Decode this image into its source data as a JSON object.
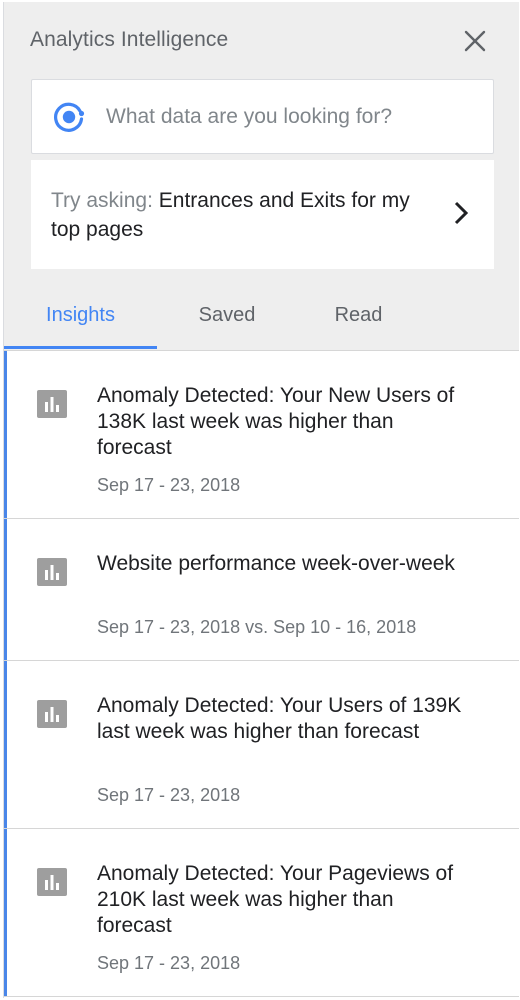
{
  "header": {
    "title": "Analytics Intelligence",
    "close_icon": "close-icon"
  },
  "search": {
    "icon": "analytics-intelligence-icon",
    "placeholder": "What data are you looking for?",
    "value": ""
  },
  "suggestion": {
    "prefix": "Try asking:",
    "query": "Entrances and Exits for my top pages",
    "chevron_icon": "chevron-right-icon"
  },
  "tabs": [
    {
      "label": "Insights",
      "active": true
    },
    {
      "label": "Saved",
      "active": false
    },
    {
      "label": "Read",
      "active": false
    }
  ],
  "colors": {
    "accent": "#4285f4",
    "top_background": "#eeeeee",
    "text_primary": "#202124",
    "text_secondary": "#70757a",
    "icon_gray": "#9e9e9e"
  },
  "insights": [
    {
      "icon": "bar-chart-icon",
      "title": "Anomaly Detected: Your New Users of 138K last week was higher than forecast",
      "date": "Sep 17 - 23, 2018"
    },
    {
      "icon": "bar-chart-icon",
      "title": "Website performance week-over-week",
      "date": "Sep 17 - 23, 2018 vs. Sep 10 - 16, 2018"
    },
    {
      "icon": "bar-chart-icon",
      "title": "Anomaly Detected: Your Users of 139K last week was higher than forecast",
      "date": "Sep 17 - 23, 2018"
    },
    {
      "icon": "bar-chart-icon",
      "title": "Anomaly Detected: Your Pageviews of 210K last week was higher than forecast",
      "date": "Sep 17 - 23, 2018"
    }
  ]
}
